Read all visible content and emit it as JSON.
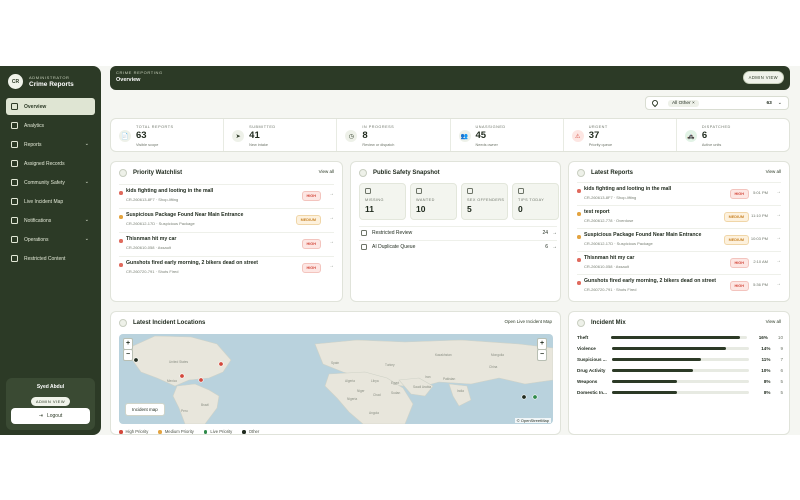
{
  "sidebar": {
    "brand_initials": "CR",
    "brand_kicker": "ADMINISTRATOR",
    "brand_title": "Crime Reports",
    "items": [
      {
        "label": "Overview"
      },
      {
        "label": "Analytics"
      },
      {
        "label": "Reports"
      },
      {
        "label": "Assigned Records"
      },
      {
        "label": "Community Safety"
      },
      {
        "label": "Live Incident Map"
      },
      {
        "label": "Notifications"
      },
      {
        "label": "Operations"
      },
      {
        "label": "Restricted Content"
      }
    ],
    "user_name": "Syed Abdul",
    "user_role": "ADMIN VIEW",
    "logout_label": "Logout"
  },
  "banner": {
    "kicker": "CRIME REPORTING",
    "title": "Overview",
    "badge": "ADMIN VIEW"
  },
  "filter": {
    "chip": "All Other",
    "chip_close": "×",
    "count": "63",
    "chevron": "⌄"
  },
  "stats": [
    {
      "label": "TOTAL REPORTS",
      "value": "63",
      "sub": "Visible scope",
      "icon": "📄"
    },
    {
      "label": "SUBMITTED",
      "value": "41",
      "sub": "New intake",
      "icon": "➤"
    },
    {
      "label": "IN PROGRESS",
      "value": "8",
      "sub": "Review or dispatch",
      "icon": "◷"
    },
    {
      "label": "UNASSIGNED",
      "value": "45",
      "sub": "Needs owner",
      "icon": "👥"
    },
    {
      "label": "URGENT",
      "value": "37",
      "sub": "Priority queue",
      "icon": "⚠"
    },
    {
      "label": "DISPATCHED",
      "value": "6",
      "sub": "Active units",
      "icon": "🚓"
    }
  ],
  "watchlist": {
    "title": "Priority Watchlist",
    "link": "View all",
    "rows": [
      {
        "title": "kids fighting and looting in the mall",
        "sub": "CR-260613-8F7 · Shop-lifting",
        "badge": "HIGH",
        "level": "high"
      },
      {
        "title": "Suspicious Package Found Near Main Entrance",
        "sub": "CR-260612-17D · Suspicious Package",
        "badge": "MEDIUM",
        "level": "med"
      },
      {
        "title": "Thisnman hit my car",
        "sub": "CR-260610-058 · Assault",
        "badge": "HIGH",
        "level": "high"
      },
      {
        "title": "Gunshots fired early morning, 2 bikers dead on street",
        "sub": "CR-260720-791 · Shots Fired",
        "badge": "HIGH",
        "level": "high"
      }
    ]
  },
  "snapshot": {
    "title": "Public Safety Snapshot",
    "tiles": [
      {
        "label": "MISSING",
        "value": "11"
      },
      {
        "label": "WANTED",
        "value": "10"
      },
      {
        "label": "SEX OFFENDERS",
        "value": "5"
      },
      {
        "label": "TIPS TODAY",
        "value": "0"
      }
    ],
    "lines": [
      {
        "label": "Restricted Review",
        "value": "24"
      },
      {
        "label": "AI Duplicate Queue",
        "value": "6"
      }
    ]
  },
  "latest": {
    "title": "Latest Reports",
    "link": "View all",
    "rows": [
      {
        "title": "kids fighting and looting in the mall",
        "sub": "CR-260613-8F7 · Shop-lifting",
        "badge": "HIGH",
        "level": "high",
        "time": "5:01 PM"
      },
      {
        "title": "test report",
        "sub": "CR-260612-778 · Overdose",
        "badge": "MEDIUM",
        "level": "med",
        "time": "11:10 PM"
      },
      {
        "title": "Suspicious Package Found Near Main Entrance",
        "sub": "CR-260612-17D · Suspicious Package",
        "badge": "MEDIUM",
        "level": "med",
        "time": "10:03 PM"
      },
      {
        "title": "Thisnman hit my car",
        "sub": "CR-260610-058 · Assault",
        "badge": "HIGH",
        "level": "high",
        "time": "2:10 AM"
      },
      {
        "title": "Gunshots fired early morning, 2 bikers dead on street",
        "sub": "CR-260720-791 · Shots Fired",
        "badge": "HIGH",
        "level": "high",
        "time": "5:36 PM"
      }
    ]
  },
  "map": {
    "title": "Latest Incident Locations",
    "link": "Open Live Incident Map",
    "zoom_in": "+",
    "zoom_out": "−",
    "pill": "Incident map",
    "attribution": "© OpenStreetMap",
    "place_labels": [
      "United States",
      "Mexico",
      "Brazil",
      "Peru",
      "Algeria",
      "Libya",
      "Egypt",
      "Niger",
      "Sudan",
      "Nigeria",
      "Chad",
      "Angola",
      "Saudi Arabia",
      "Iran",
      "Pakistan",
      "India",
      "China",
      "Mongolia",
      "Kazakhstan",
      "Turkey",
      "Spain"
    ],
    "legend": [
      {
        "label": "High Priority",
        "color": "#d3483b"
      },
      {
        "label": "Medium Priority",
        "color": "#e3a33f"
      },
      {
        "label": "Live Priority",
        "color": "#2f8a4a"
      },
      {
        "label": "Other",
        "color": "#1f2a1d"
      }
    ]
  },
  "mix": {
    "title": "Incident Mix",
    "link": "View all",
    "rows": [
      {
        "label": "Theft",
        "pct": "16%",
        "value": 16,
        "count": "10"
      },
      {
        "label": "Violence",
        "pct": "14%",
        "value": 14,
        "count": "9"
      },
      {
        "label": "Suspicious ...",
        "pct": "11%",
        "value": 11,
        "count": "7"
      },
      {
        "label": "Drug Activity",
        "pct": "10%",
        "value": 10,
        "count": "6"
      },
      {
        "label": "Weapons",
        "pct": "8%",
        "value": 8,
        "count": "5"
      },
      {
        "label": "Domestic In...",
        "pct": "8%",
        "value": 8,
        "count": "5"
      }
    ]
  },
  "colors": {
    "brand": "#2c3a26",
    "high": "#d3483b",
    "medium": "#e3a33f"
  }
}
